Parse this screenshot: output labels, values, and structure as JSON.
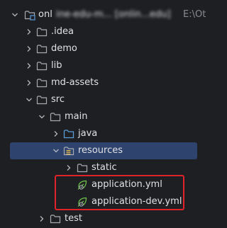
{
  "project": {
    "name": "onl",
    "name_obscured": "ine-edu-m... [onlin...edu]",
    "path": "E:\\Ot"
  },
  "items": [
    {
      "label": "onl",
      "type": "project",
      "icon": "module-folder-icon"
    },
    {
      "label": ".idea",
      "type": "folder",
      "icon": "folder-icon"
    },
    {
      "label": "demo",
      "type": "folder",
      "icon": "folder-icon"
    },
    {
      "label": "lib",
      "type": "folder",
      "icon": "folder-icon"
    },
    {
      "label": "md-assets",
      "type": "folder",
      "icon": "folder-icon"
    },
    {
      "label": "src",
      "type": "folder",
      "icon": "folder-icon"
    },
    {
      "label": "main",
      "type": "folder",
      "icon": "folder-icon"
    },
    {
      "label": "java",
      "type": "source-folder",
      "icon": "source-folder-icon"
    },
    {
      "label": "resources",
      "type": "resources-folder",
      "icon": "resources-folder-icon"
    },
    {
      "label": "static",
      "type": "folder",
      "icon": "folder-icon"
    },
    {
      "label": "application.yml",
      "type": "file",
      "icon": "spring-config-icon"
    },
    {
      "label": "application-dev.yml",
      "type": "file",
      "icon": "spring-config-icon"
    },
    {
      "label": "test",
      "type": "folder",
      "icon": "folder-icon"
    }
  ],
  "colors": {
    "background": "#1e1f22",
    "selection": "#2e436e",
    "highlight_border": "#e0222a",
    "folder": "#a6aab2",
    "source_folder": "#5b9bd5",
    "spring": "#6cbf4a"
  }
}
